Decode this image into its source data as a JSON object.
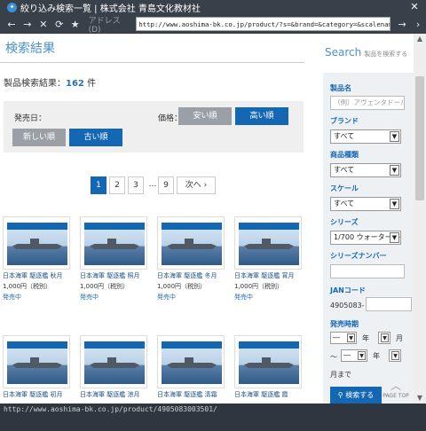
{
  "window": {
    "title": "絞り込み検索一覧 | 株式会社 青島文化教材社",
    "close_glyph": "✕"
  },
  "toolbar": {
    "back": "←",
    "forward": "→",
    "stop": "✕",
    "refresh": "⟳",
    "favorite": "★",
    "address_label": "アドレス(D)",
    "address": "http://www.aoshima-bk.co.jp/product/?s=&brand=&category=&scalename=&seri",
    "go": "→",
    "more": "›"
  },
  "page": {
    "title": "検索結果",
    "result_label": "製品検索結果：",
    "result_count": "162",
    "result_unit": "件",
    "sort": {
      "date_label": "発売日：",
      "price_label": "価格：",
      "cheap": "安い順",
      "expensive": "高い順",
      "newest": "新しい順",
      "oldest": "古い順"
    },
    "pager": [
      "1",
      "2",
      "3",
      "…",
      "9",
      "次へ ›"
    ],
    "products": [
      {
        "name": "日本海軍 駆逐艦 秋月",
        "price": "1,000円（税別）",
        "status": "発売中"
      },
      {
        "name": "日本海軍 駆逐艦 照月",
        "price": "1,000円（税別）",
        "status": "発売中"
      },
      {
        "name": "日本海軍 駆逐艦 冬月",
        "price": "1,000円（税別）",
        "status": "発売中"
      },
      {
        "name": "日本海軍 駆逐艦 宵月",
        "price": "1,000円（税別）",
        "status": "発売中"
      },
      {
        "name": "日本海軍 駆逐艦 初月",
        "price": "",
        "status": ""
      },
      {
        "name": "日本海軍 駆逐艦 涼月",
        "price": "",
        "status": ""
      },
      {
        "name": "日本海軍 駆逐艦 清霜",
        "price": "",
        "status": ""
      },
      {
        "name": "日本海軍 駆逐艦 霞",
        "price": "",
        "status": ""
      }
    ]
  },
  "sidebar": {
    "heading": "Search",
    "heading_sub": "製品を検索する",
    "product_name_label": "製品名",
    "product_name_placeholder": "（例）アヴェンタドール",
    "brand_label": "ブランド",
    "brand_value": "すべて",
    "category_label": "商品種類",
    "category_value": "すべて",
    "scale_label": "スケール",
    "scale_value": "すべて",
    "series_label": "シリーズ",
    "series_value": "1/700 ウォーターライン",
    "series_number_label": "シリーズナンバー",
    "jan_label": "JANコード",
    "jan_prefix": "4905083-",
    "release_label": "発売時期",
    "dash": "―",
    "year": "年",
    "month": "月",
    "tilde": "～",
    "until": "月まで",
    "search_button": "検索する",
    "page_top": "PAGE TOP"
  },
  "statusbar": {
    "url": "http://www.aoshima-bk.co.jp/product/4905083003501/"
  }
}
